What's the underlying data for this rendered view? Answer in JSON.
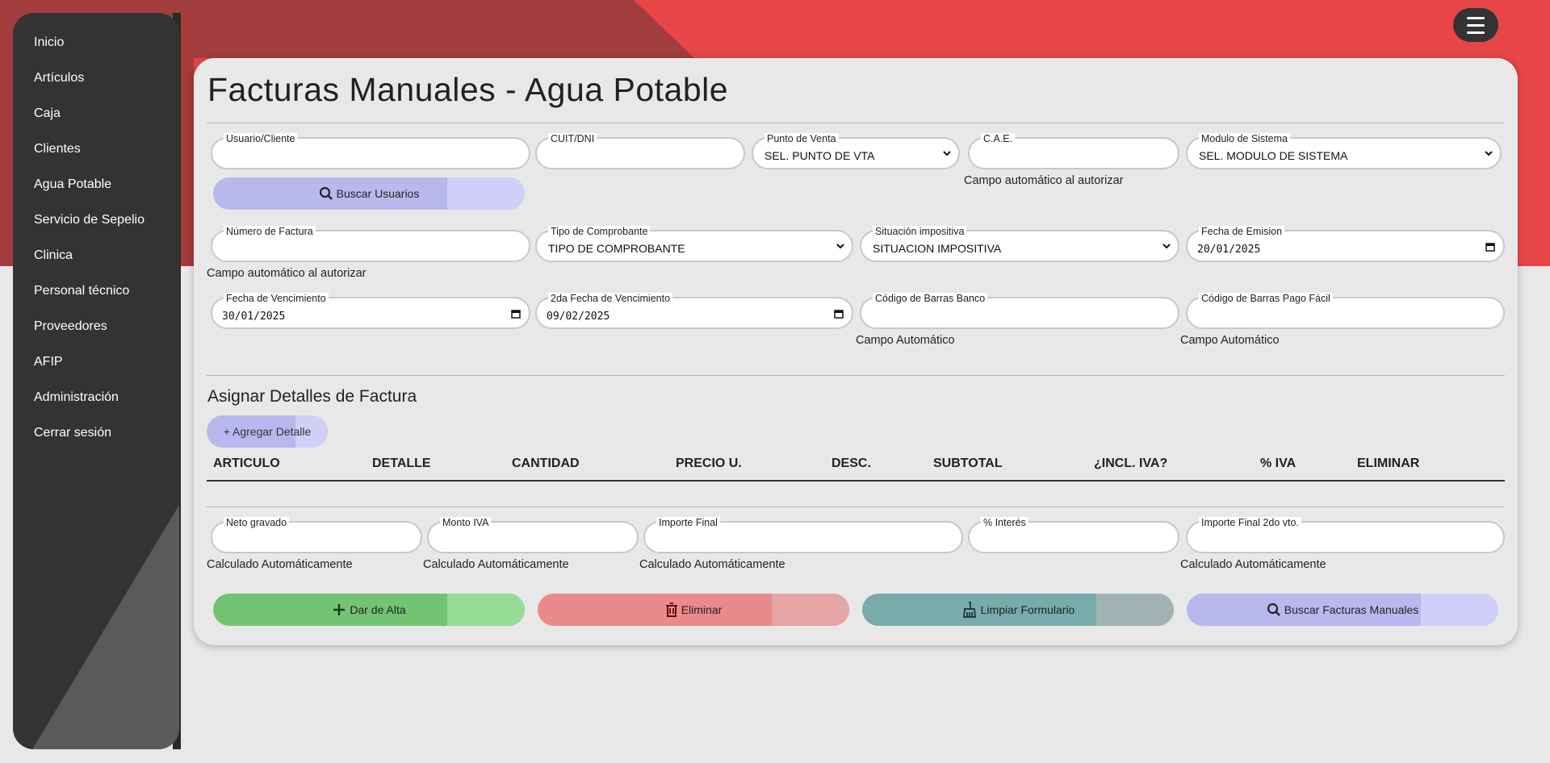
{
  "sidebar": {
    "items": [
      {
        "label": "Inicio"
      },
      {
        "label": "Artículos"
      },
      {
        "label": "Caja"
      },
      {
        "label": "Clientes"
      },
      {
        "label": "Agua Potable"
      },
      {
        "label": "Servicio de Sepelio"
      },
      {
        "label": "Clinica"
      },
      {
        "label": "Personal técnico"
      },
      {
        "label": "Proveedores"
      },
      {
        "label": "AFIP"
      },
      {
        "label": "Administración"
      },
      {
        "label": "Cerrar sesión"
      }
    ]
  },
  "header": {
    "menu_icon": "hamburger-icon"
  },
  "page": {
    "title": "Facturas Manuales - Agua Potable"
  },
  "form": {
    "usuario_label": "Usuario/Cliente",
    "usuario_value": "",
    "cuit_label": "CUIT/DNI",
    "cuit_value": "",
    "punto_venta_label": "Punto de Venta",
    "punto_venta_value": "SEL. PUNTO DE VTA",
    "cae_label": "C.A.E.",
    "cae_value": "",
    "cae_hint": "Campo automático al autorizar",
    "modulo_label": "Modulo de Sistema",
    "modulo_value": "SEL. MODULO DE SISTEMA",
    "buscar_usuarios": "Buscar Usuarios",
    "numero_factura_label": "Número de Factura",
    "numero_factura_value": "",
    "numero_factura_hint": "Campo automático al autorizar",
    "tipo_comprobante_label": "Tipo de Comprobante",
    "tipo_comprobante_value": "TIPO DE COMPROBANTE",
    "situacion_label": "Situación impositiva",
    "situacion_value": "SITUACION IMPOSITIVA",
    "fecha_emision_label": "Fecha de Emision",
    "fecha_emision_value": "20/01/2025",
    "fecha_venc_label": "Fecha de Vencimiento",
    "fecha_venc_value": "30/01/2025",
    "fecha_venc2_label": "2da Fecha de Vencimiento",
    "fecha_venc2_value": "09/02/2025",
    "barras_banco_label": "Código de Barras Banco",
    "barras_banco_value": "",
    "barras_banco_hint": "Campo Automático",
    "barras_pagofacil_label": "Código de Barras Pago Fácil",
    "barras_pagofacil_value": "",
    "barras_pagofacil_hint": "Campo Automático"
  },
  "details": {
    "title": "Asignar Detalles de Factura",
    "add_button": "+ Agregar Detalle",
    "columns": [
      "ARTICULO",
      "DETALLE",
      "CANTIDAD",
      "PRECIO U.",
      "DESC.",
      "SUBTOTAL",
      "¿INCL. IVA?",
      "% IVA",
      "ELIMINAR"
    ]
  },
  "totals": {
    "neto_label": "Neto gravado",
    "neto_hint": "Calculado Automáticamente",
    "iva_label": "Monto IVA",
    "iva_hint": "Calculado Automáticamente",
    "importe_label": "Importe Final",
    "importe_hint": "Calculado Automáticamente",
    "interes_label": "% Interés",
    "importe2_label": "Importe Final 2do vto.",
    "importe2_hint": "Calculado Automáticamente"
  },
  "actions": {
    "alta": "Dar de Alta",
    "eliminar": "Eliminar",
    "limpiar": "Limpiar Formulario",
    "buscar": "Buscar Facturas Manuales"
  },
  "colors": {
    "header_red": "#e84646",
    "header_dark": "#a33c3c",
    "sidebar": "#333333",
    "btn_purple": "#b8b8ef",
    "btn_green": "#72c472",
    "btn_red": "#ea8a8a",
    "btn_teal": "#78abab"
  }
}
